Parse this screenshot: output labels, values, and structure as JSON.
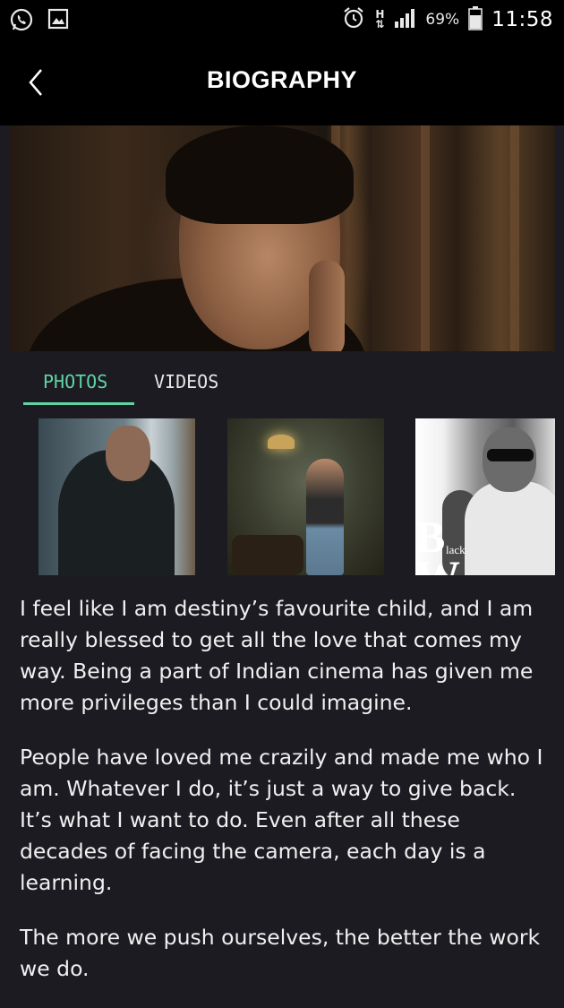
{
  "status_bar": {
    "battery": "69%",
    "time": "11:58",
    "network_type": "H",
    "icons": [
      "whatsapp-icon",
      "gallery-icon",
      "alarm-icon",
      "signal-icon",
      "battery-icon"
    ]
  },
  "header": {
    "title": "BIOGRAPHY",
    "back_icon": "chevron-left-icon"
  },
  "tabs": [
    {
      "label": "PHOTOS",
      "active": true
    },
    {
      "label": "VIDEOS",
      "active": false
    }
  ],
  "colors": {
    "accent": "#5fd3a4",
    "background": "#1c1b22",
    "header": "#000000"
  },
  "thumbnail_overlay": {
    "big_letter": "B",
    "small_word": "lack",
    "second_letter": "W"
  },
  "bio": {
    "paragraphs": [
      "I feel like I am destiny’s favourite child, and I am really blessed to get all the love that comes my way. Being a part of Indian cinema has given me more privileges than I could imagine.",
      "People have loved me crazily and made me who I am. Whatever I do, it’s just a way to give back. It’s what I want to do. Even after all these decades of facing the camera, each day is a learning.",
      "The more we push ourselves, the better the work we do."
    ]
  }
}
